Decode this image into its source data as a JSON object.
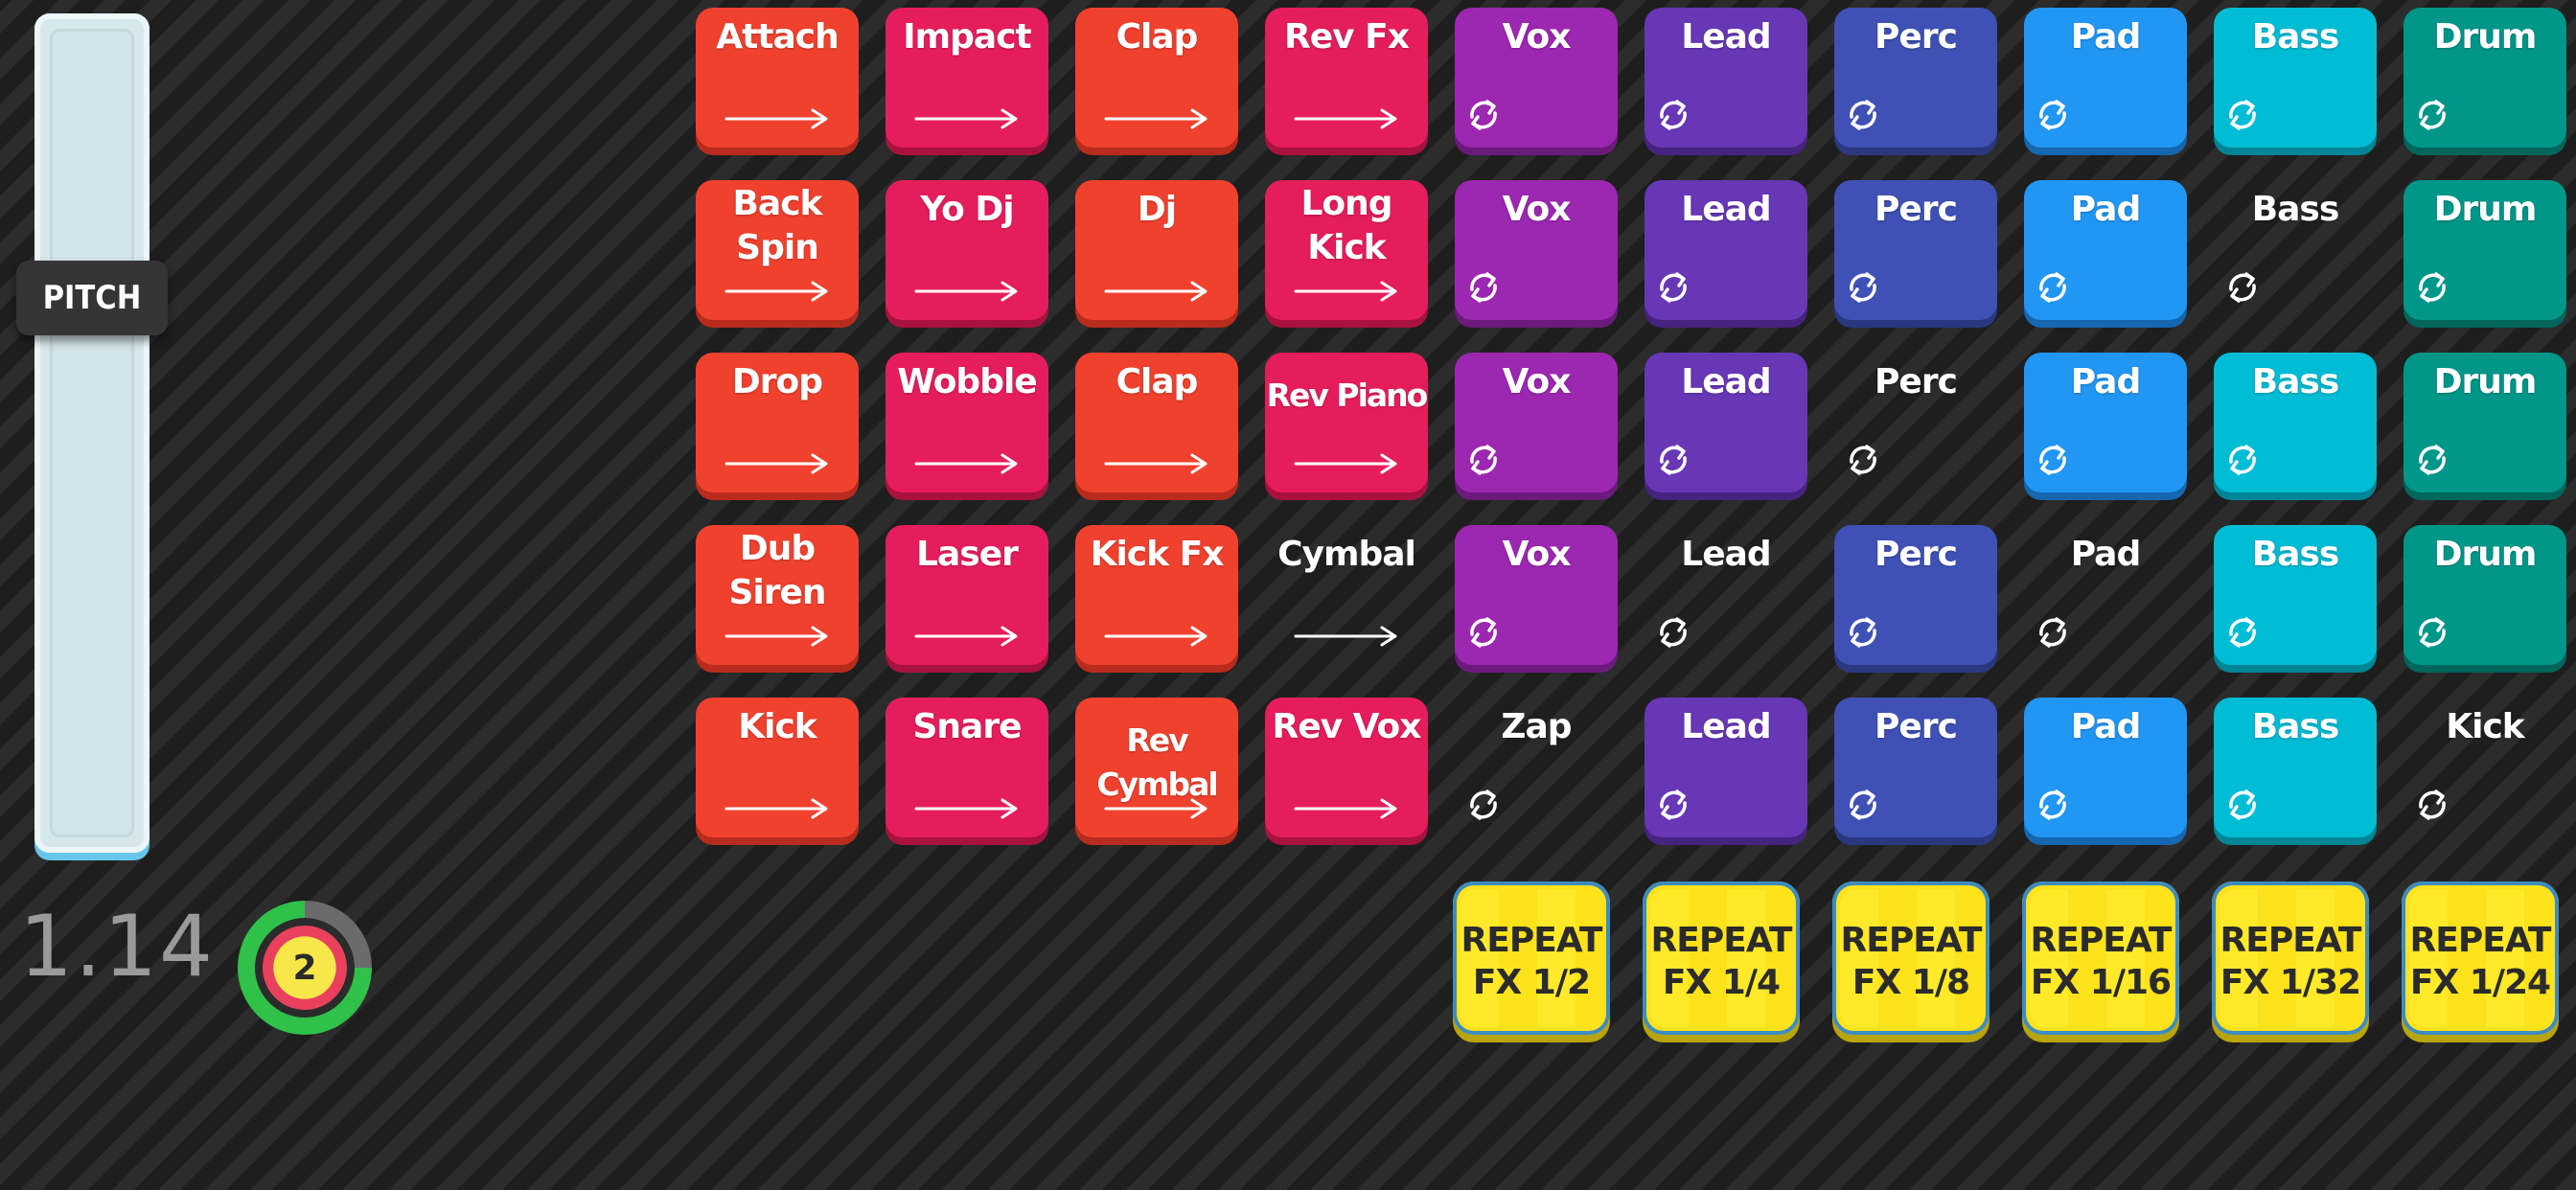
{
  "pitch": {
    "label": "PITCH",
    "value": "1.14"
  },
  "beat_counter": {
    "value": "2",
    "progress": 0.75
  },
  "colors": {
    "orange": "#f0412f",
    "pink": "#e61d5c",
    "purple": "#9c27b0",
    "violet": "#6737b6",
    "indigo": "#3f51b5",
    "blue": "#2196f3",
    "cyan": "#00bcd4",
    "teal": "#009688",
    "inactive": "#303030",
    "repeat": "#fde21c"
  },
  "pad_rows": [
    [
      {
        "label": "Attach",
        "color": "orange",
        "icon": "arrow-right-icon"
      },
      {
        "label": "Impact",
        "color": "pink",
        "icon": "arrow-right-icon"
      },
      {
        "label": "Clap",
        "color": "orange",
        "icon": "arrow-right-icon"
      },
      {
        "label": "Rev Fx",
        "color": "pink",
        "icon": "arrow-right-icon"
      },
      {
        "label": "Vox",
        "color": "purple",
        "icon": "loop-icon"
      },
      {
        "label": "Lead",
        "color": "violet",
        "icon": "loop-icon"
      },
      {
        "label": "Perc",
        "color": "indigo",
        "icon": "loop-icon"
      },
      {
        "label": "Pad",
        "color": "blue",
        "icon": "loop-icon"
      },
      {
        "label": "Bass",
        "color": "cyan",
        "icon": "loop-icon"
      },
      {
        "label": "Drum",
        "color": "teal",
        "icon": "loop-icon"
      }
    ],
    [
      {
        "label": "Back\nSpin",
        "color": "orange",
        "icon": "arrow-right-icon"
      },
      {
        "label": "Yo Dj",
        "color": "pink",
        "icon": "arrow-right-icon"
      },
      {
        "label": "Dj",
        "color": "orange",
        "icon": "arrow-right-icon"
      },
      {
        "label": "Long\nKick",
        "color": "pink",
        "icon": "arrow-right-icon"
      },
      {
        "label": "Vox",
        "color": "purple",
        "icon": "loop-icon"
      },
      {
        "label": "Lead",
        "color": "violet",
        "icon": "loop-icon"
      },
      {
        "label": "Perc",
        "color": "indigo",
        "icon": "loop-icon"
      },
      {
        "label": "Pad",
        "color": "blue",
        "icon": "loop-icon"
      },
      {
        "label": "Bass",
        "color": "inactive",
        "icon": "loop-icon"
      },
      {
        "label": "Drum",
        "color": "teal",
        "icon": "loop-icon"
      }
    ],
    [
      {
        "label": "Drop",
        "color": "orange",
        "icon": "arrow-right-icon"
      },
      {
        "label": "Wobble",
        "color": "pink",
        "icon": "arrow-right-icon"
      },
      {
        "label": "Clap",
        "color": "orange",
        "icon": "arrow-right-icon"
      },
      {
        "label": "Rev Piano",
        "color": "pink",
        "icon": "arrow-right-icon"
      },
      {
        "label": "Vox",
        "color": "purple",
        "icon": "loop-icon"
      },
      {
        "label": "Lead",
        "color": "violet",
        "icon": "loop-icon"
      },
      {
        "label": "Perc",
        "color": "inactive",
        "icon": "loop-icon"
      },
      {
        "label": "Pad",
        "color": "blue",
        "icon": "loop-icon"
      },
      {
        "label": "Bass",
        "color": "cyan",
        "icon": "loop-icon"
      },
      {
        "label": "Drum",
        "color": "teal",
        "icon": "loop-icon"
      }
    ],
    [
      {
        "label": "Dub\nSiren",
        "color": "orange",
        "icon": "arrow-right-icon"
      },
      {
        "label": "Laser",
        "color": "pink",
        "icon": "arrow-right-icon"
      },
      {
        "label": "Kick Fx",
        "color": "orange",
        "icon": "arrow-right-icon"
      },
      {
        "label": "Cymbal",
        "color": "inactive",
        "icon": "arrow-right-icon"
      },
      {
        "label": "Vox",
        "color": "purple",
        "icon": "loop-icon"
      },
      {
        "label": "Lead",
        "color": "inactive",
        "icon": "loop-icon"
      },
      {
        "label": "Perc",
        "color": "indigo",
        "icon": "loop-icon"
      },
      {
        "label": "Pad",
        "color": "inactive",
        "icon": "loop-icon"
      },
      {
        "label": "Bass",
        "color": "cyan",
        "icon": "loop-icon"
      },
      {
        "label": "Drum",
        "color": "teal",
        "icon": "loop-icon"
      }
    ],
    [
      {
        "label": "Kick",
        "color": "orange",
        "icon": "arrow-right-icon"
      },
      {
        "label": "Snare",
        "color": "pink",
        "icon": "arrow-right-icon"
      },
      {
        "label": "Rev Cymbal",
        "color": "orange",
        "icon": "arrow-right-icon"
      },
      {
        "label": "Rev Vox",
        "color": "pink",
        "icon": "arrow-right-icon"
      },
      {
        "label": "Zap",
        "color": "inactive",
        "icon": "loop-icon"
      },
      {
        "label": "Lead",
        "color": "violet",
        "icon": "loop-icon"
      },
      {
        "label": "Perc",
        "color": "indigo",
        "icon": "loop-icon"
      },
      {
        "label": "Pad",
        "color": "blue",
        "icon": "loop-icon"
      },
      {
        "label": "Bass",
        "color": "cyan",
        "icon": "loop-icon"
      },
      {
        "label": "Kick",
        "color": "inactive",
        "icon": "loop-icon"
      }
    ]
  ],
  "repeat_fx": [
    "REPEAT\nFX 1/2",
    "REPEAT\nFX 1/4",
    "REPEAT\nFX 1/8",
    "REPEAT\nFX 1/16",
    "REPEAT\nFX 1/32",
    "REPEAT\nFX 1/24"
  ]
}
